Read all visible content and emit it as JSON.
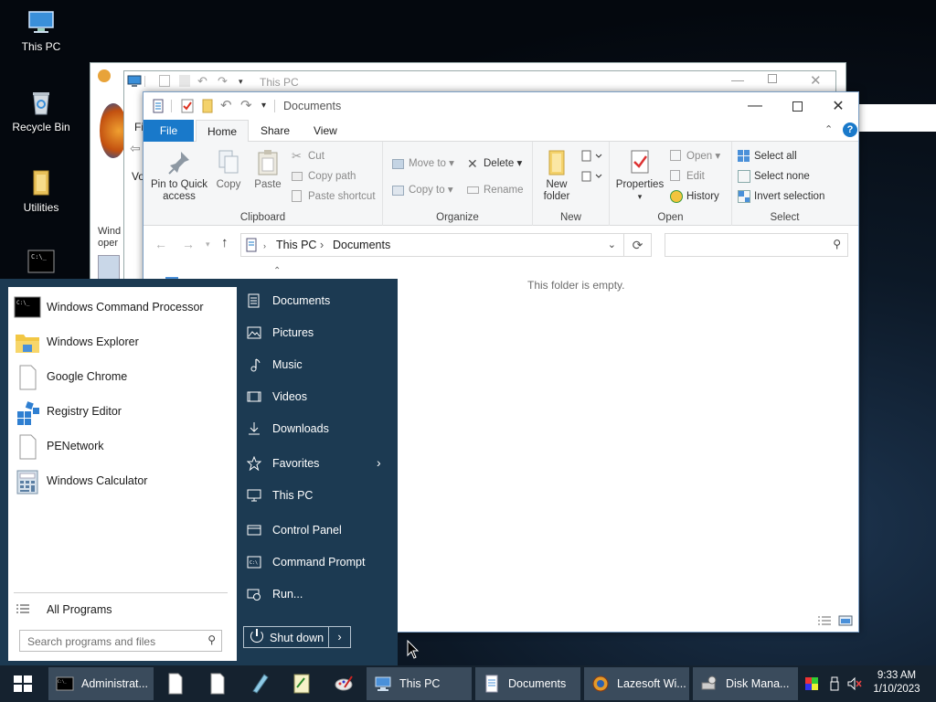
{
  "desktop": {
    "icons": [
      {
        "label": "This PC",
        "icon": "computer-icon"
      },
      {
        "label": "Recycle Bin",
        "icon": "recycle-bin-icon"
      },
      {
        "label": "Utilities",
        "icon": "folder-icon"
      },
      {
        "label": "",
        "icon": "console-icon"
      }
    ]
  },
  "background_windows": {
    "back_title": "This PC",
    "partial_labels": {
      "fi": "Fi",
      "vo": "Vo",
      "wind": "Wind",
      "oper": "oper"
    }
  },
  "explorer": {
    "title": "Documents",
    "tabs": {
      "file": "File",
      "home": "Home",
      "share": "Share",
      "view": "View"
    },
    "ribbon": {
      "clipboard": {
        "pin": "Pin to Quick access",
        "copy": "Copy",
        "paste": "Paste",
        "cut": "Cut",
        "copy_path": "Copy path",
        "paste_shortcut": "Paste shortcut",
        "group_label": "Clipboard"
      },
      "organize": {
        "move_to": "Move to",
        "copy_to": "Copy to",
        "delete": "Delete",
        "rename": "Rename",
        "group_label": "Organize"
      },
      "new": {
        "new_folder": "New folder",
        "group_label": "New"
      },
      "open": {
        "properties": "Properties",
        "open": "Open",
        "edit": "Edit",
        "history": "History",
        "group_label": "Open"
      },
      "select": {
        "select_all": "Select all",
        "select_none": "Select none",
        "invert_selection": "Invert selection",
        "group_label": "Select"
      }
    },
    "address": {
      "seg1": "This PC",
      "seg2": "Documents"
    },
    "search_placeholder": "",
    "empty_message": "This folder is empty."
  },
  "start_menu": {
    "programs": [
      {
        "label": "Windows Command Processor",
        "icon": "cmd-icon"
      },
      {
        "label": "Windows Explorer",
        "icon": "explorer-folder-icon"
      },
      {
        "label": "Google Chrome",
        "icon": "blank-file-icon"
      },
      {
        "label": "Registry Editor",
        "icon": "registry-icon"
      },
      {
        "label": "PENetwork",
        "icon": "blank-file-icon"
      },
      {
        "label": "Windows Calculator",
        "icon": "calculator-icon"
      }
    ],
    "all_programs": "All Programs",
    "search_placeholder": "Search programs and files",
    "places": [
      {
        "label": "Documents",
        "icon": "document-icon"
      },
      {
        "label": "Pictures",
        "icon": "picture-icon"
      },
      {
        "label": "Music",
        "icon": "music-icon"
      },
      {
        "label": "Videos",
        "icon": "video-icon"
      },
      {
        "label": "Downloads",
        "icon": "download-icon"
      },
      {
        "label": "Favorites",
        "icon": "star-icon"
      },
      {
        "label": "This PC",
        "icon": "monitor-icon"
      },
      {
        "label": "Control Panel",
        "icon": "control-panel-icon"
      },
      {
        "label": "Command Prompt",
        "icon": "command-prompt-icon"
      },
      {
        "label": "Run...",
        "icon": "run-icon"
      }
    ],
    "shutdown": "Shut down"
  },
  "taskbar": {
    "buttons": [
      {
        "label": "Administrat...",
        "icon": "cmd-icon"
      },
      {
        "label": "This PC",
        "icon": "computer-icon"
      },
      {
        "label": "Documents",
        "icon": "document-icon"
      },
      {
        "label": "Lazesoft Wi...",
        "icon": "lazesoft-icon"
      },
      {
        "label": "Disk Mana...",
        "icon": "disk-icon"
      }
    ],
    "time": "9:33 AM",
    "date": "1/10/2023"
  },
  "colors": {
    "accent": "#1979ca",
    "start_menu_bg": "#1c3a52",
    "taskbar_bg": "#15222f"
  }
}
